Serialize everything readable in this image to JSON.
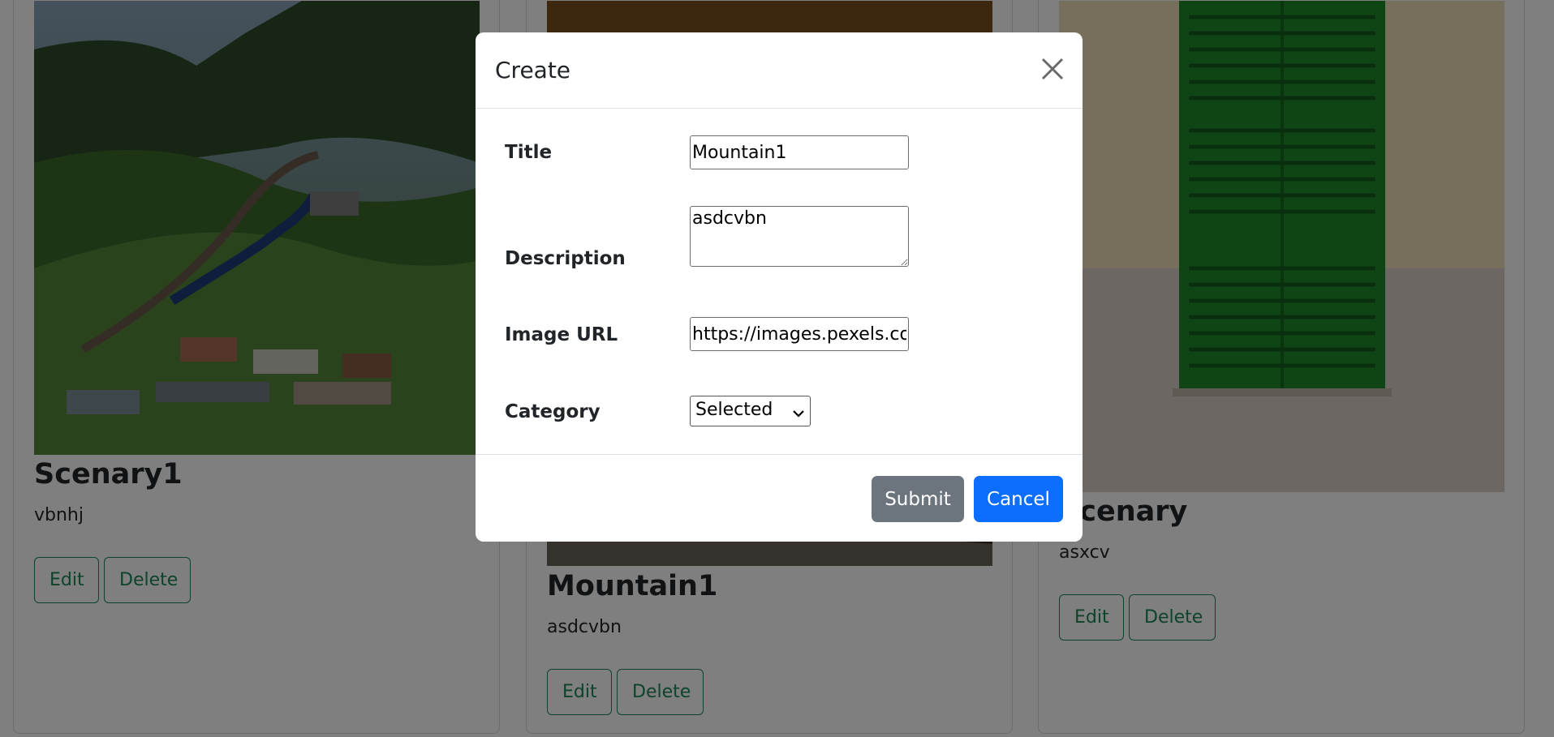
{
  "cards": [
    {
      "title": "Scenary1",
      "description": "vbnhj",
      "edit_label": "Edit",
      "delete_label": "Delete"
    },
    {
      "title": "Mountain1",
      "description": "asdcvbn",
      "edit_label": "Edit",
      "delete_label": "Delete"
    },
    {
      "title": "Scenary",
      "description": "asxcv",
      "edit_label": "Edit",
      "delete_label": "Delete"
    }
  ],
  "modal": {
    "title": "Create",
    "fields": {
      "title_label": "Title",
      "title_value": "Mountain1",
      "description_label": "Description",
      "description_value": "asdcvbn",
      "image_url_label": "Image URL",
      "image_url_value": "https://images.pexels.com",
      "category_label": "Category",
      "category_value": "Selected"
    },
    "submit_label": "Submit",
    "cancel_label": "Cancel"
  },
  "colors": {
    "submit": "#6c757d",
    "cancel": "#0d6efd",
    "outline_button": "#198754",
    "backdrop": "rgba(0,0,0,0.5)"
  },
  "icons": {
    "close": "close-icon",
    "select_arrow": "chevron-down-icon"
  }
}
